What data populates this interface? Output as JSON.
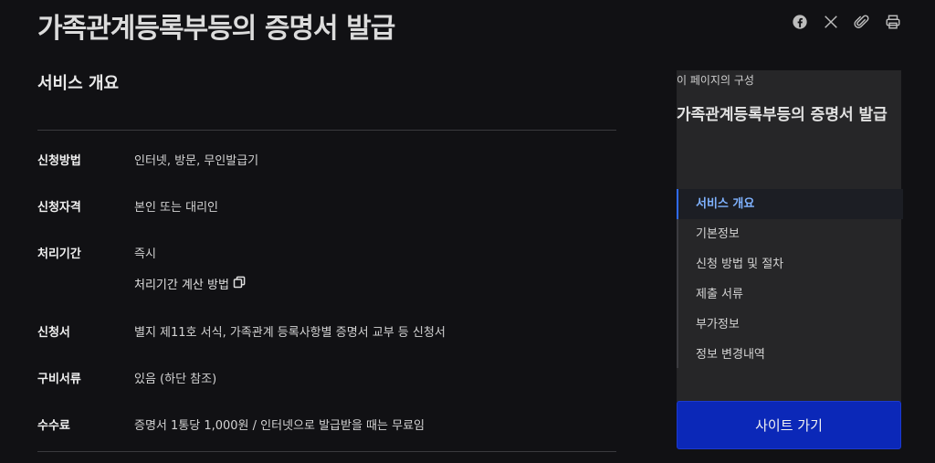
{
  "page": {
    "title": "가족관계등록부등의 증명서 발급"
  },
  "share": {
    "icons": [
      "facebook-icon",
      "x-icon",
      "attach-link-icon",
      "print-icon"
    ]
  },
  "service": {
    "title": "서비스 개요",
    "rows": [
      {
        "label": "신청방법",
        "value": "인터넷, 방문, 무인발급기"
      },
      {
        "label": "신청자격",
        "value": "본인 또는 대리인"
      },
      {
        "label": "처리기간",
        "value": "즉시",
        "link": "처리기간 계산 방법"
      },
      {
        "label": "신청서",
        "value": "별지 제11호 서식, 가족관계 등록사항별 증명서 교부 등 신청서"
      },
      {
        "label": "구비서류",
        "value": "있음 (하단 참조)"
      },
      {
        "label": "수수료",
        "value": "증명서 1통당 1,000원 / 인터넷으로 발급받을 때는 무료임"
      }
    ]
  },
  "toc": {
    "caption": "이 페이지의 구성",
    "heading": "가족관계등록부등의 증명서 발급",
    "items": [
      "서비스 개요",
      "기본정보",
      "신청 방법 및 절차",
      "제출 서류",
      "부가정보",
      "정보 변경내역"
    ],
    "active_index": 0
  },
  "site_button": {
    "label": "사이트 가기"
  },
  "colors": {
    "background": "#111114",
    "accent_button": "#0b28b8",
    "active_toc": "#7fb2ff"
  }
}
